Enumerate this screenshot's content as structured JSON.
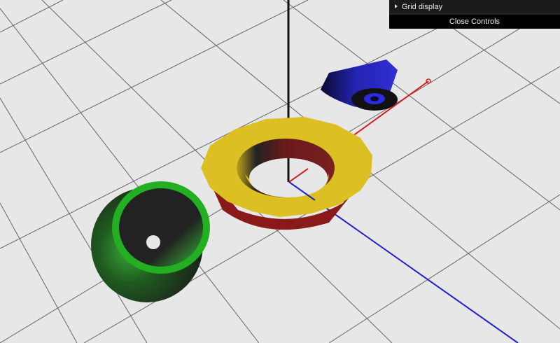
{
  "controls": {
    "folders": [
      {
        "label": "Grid display",
        "icon": "triangle-right-icon",
        "expanded": false
      }
    ],
    "close_label": "Close Controls"
  },
  "scene": {
    "background": "#e7e7e7",
    "grid_color": "#555555",
    "axes": {
      "x_color": "#cc2222",
      "y_color": "#111111",
      "z_color": "#2222cc"
    },
    "objects": [
      {
        "name": "green-bowl",
        "color": "#22b022",
        "inner": "#222222"
      },
      {
        "name": "yellow-ring",
        "color": "#dfc022",
        "inner": "#7a1a1a"
      },
      {
        "name": "blue-cone",
        "color": "#2020c8",
        "inner": "#111111"
      }
    ]
  }
}
